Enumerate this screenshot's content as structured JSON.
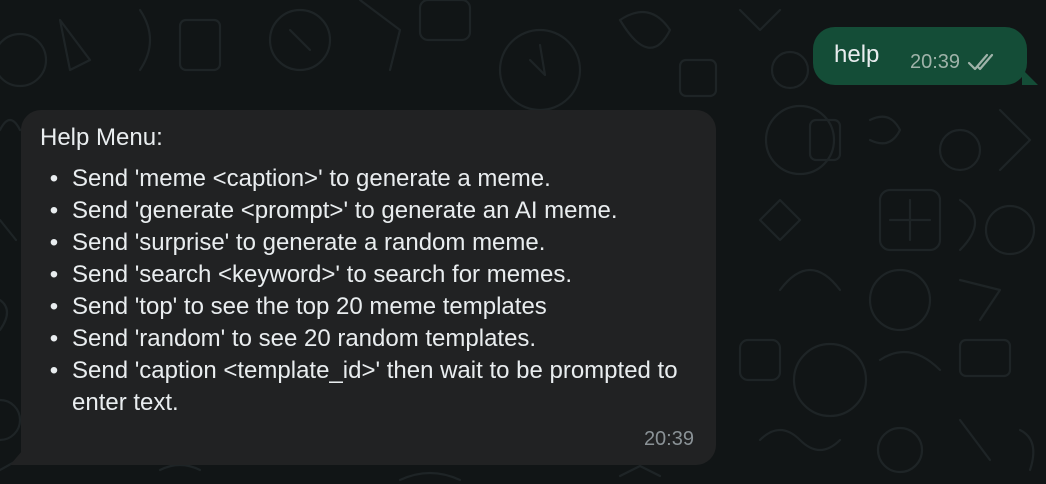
{
  "chat": {
    "background_color": "#111516",
    "outgoing_message": {
      "text": "help",
      "time": "20:39",
      "status_icon": "double-check-icon",
      "bubble_color": "#144d37"
    },
    "incoming_message": {
      "heading": "Help Menu:",
      "bubble_color": "#212223",
      "items": [
        {
          "bullet": "•",
          "text": "Send 'meme <caption>' to generate a meme."
        },
        {
          "bullet": "•",
          "text": "Send 'generate <prompt>' to generate an AI meme."
        },
        {
          "bullet": "•",
          "text": "Send 'surprise' to generate a random meme."
        },
        {
          "bullet": "•",
          "text": "Send 'search <keyword>' to search for memes."
        },
        {
          "bullet": "•",
          "text": "Send 'top' to see the top 20 meme templates"
        },
        {
          "bullet": "•",
          "text": "Send 'random' to see 20 random templates."
        },
        {
          "bullet": "•",
          "text": "Send 'caption <template_id>' then wait to be prompted to enter text."
        }
      ],
      "time": "20:39"
    }
  }
}
